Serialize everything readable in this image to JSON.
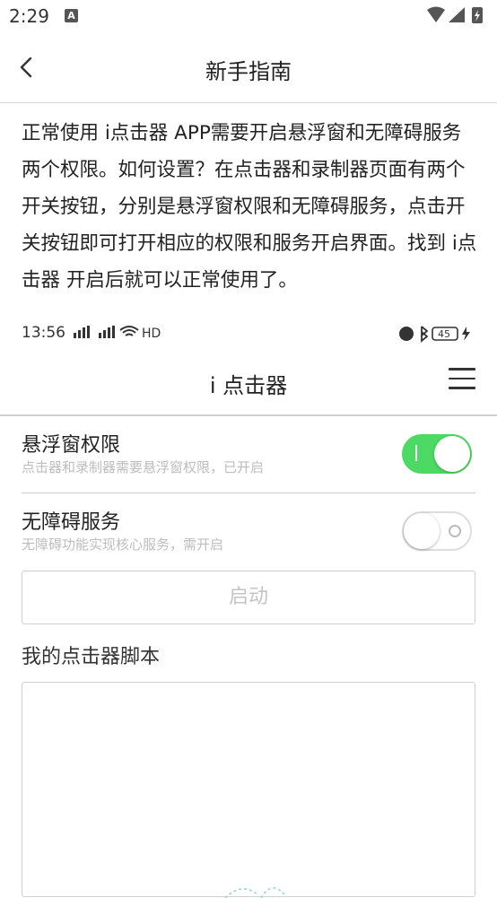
{
  "status_bar": {
    "time": "2:29",
    "notification_badge": "A"
  },
  "header": {
    "title": "新手指南",
    "back_icon": "chevron-left-icon"
  },
  "guide": {
    "text": "正常使用 i点击器 APP需要开启悬浮窗和无障碍服务两个权限。如何设置？在点击器和录制器页面有两个开关按钮，分别是悬浮窗权限和无障碍服务，点击开关按钮即可打开相应的权限和服务开启界面。找到 i点击器 开启后就可以正常使用了。"
  },
  "screenshot": {
    "status": {
      "time": "13:56",
      "network": "HD",
      "battery": "45"
    },
    "title": "i 点击器",
    "permissions": [
      {
        "title": "悬浮窗权限",
        "subtitle": "点击器和录制器需要悬浮窗权限，已开启",
        "enabled": true
      },
      {
        "title": "无障碍服务",
        "subtitle": "无障碍功能实现核心服务，需开启",
        "enabled": false
      }
    ],
    "start_label": "启动",
    "scripts_title": "我的点击器脚本"
  },
  "colors": {
    "toggle_on": "#4cd964",
    "divider": "#cfcfcf",
    "hint_text": "#bdbdbd"
  }
}
